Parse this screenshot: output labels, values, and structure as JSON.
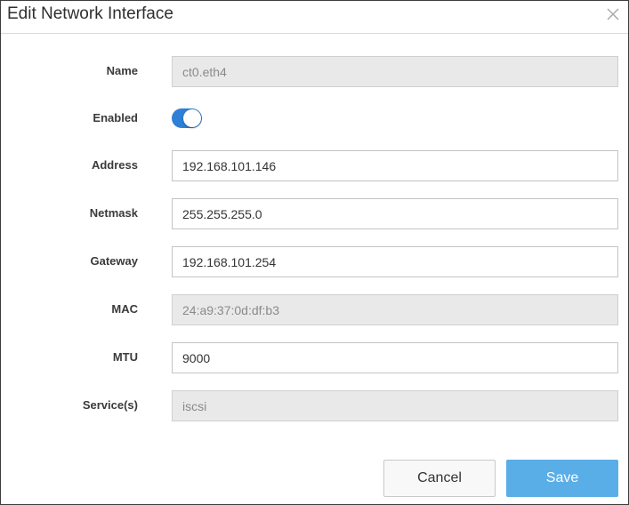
{
  "dialog": {
    "title": "Edit Network Interface",
    "close_icon": "close-icon"
  },
  "form": {
    "name": {
      "label": "Name",
      "value": "ct0.eth4",
      "readonly": true
    },
    "enabled": {
      "label": "Enabled",
      "value": true
    },
    "address": {
      "label": "Address",
      "value": "192.168.101.146"
    },
    "netmask": {
      "label": "Netmask",
      "value": "255.255.255.0"
    },
    "gateway": {
      "label": "Gateway",
      "value": "192.168.101.254"
    },
    "mac": {
      "label": "MAC",
      "value": "24:a9:37:0d:df:b3",
      "readonly": true
    },
    "mtu": {
      "label": "MTU",
      "value": "9000"
    },
    "services": {
      "label": "Service(s)",
      "value": "iscsi",
      "readonly": true
    }
  },
  "buttons": {
    "cancel": "Cancel",
    "save": "Save"
  },
  "colors": {
    "toggle_on": "#2e7fd6",
    "save_button": "#5aaee8",
    "readonly_field": "#e9e9e9"
  }
}
